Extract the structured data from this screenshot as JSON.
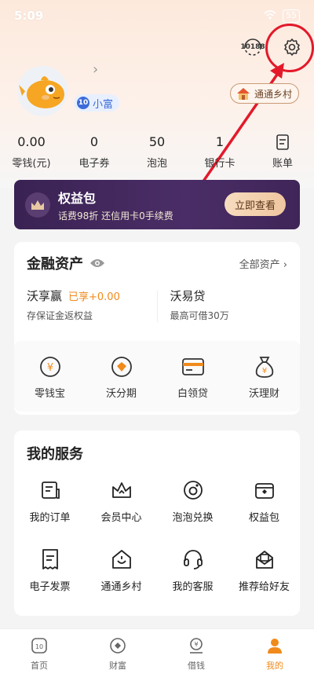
{
  "status_bar": {
    "time": "5:09",
    "battery": "55"
  },
  "header": {
    "badge_10188": "10188"
  },
  "profile": {
    "member_level": "小富",
    "member_badge_icon": "10",
    "village_label": "通通乡村"
  },
  "stats": [
    {
      "value": "0.00",
      "label": "零钱(元)"
    },
    {
      "value": "0",
      "label": "电子券"
    },
    {
      "value": "50",
      "label": "泡泡"
    },
    {
      "value": "1",
      "label": "银行卡"
    },
    {
      "value": "",
      "label": "账单"
    }
  ],
  "banner": {
    "title": "权益包",
    "subtitle": "话费98折 还信用卡0手续费",
    "button": "立即查看"
  },
  "finance": {
    "title": "金融资产",
    "all_assets": "全部资产",
    "products": [
      {
        "name": "沃享赢",
        "tag": "已享+0.00",
        "desc": "存保证金返权益"
      },
      {
        "name": "沃易贷",
        "tag": "",
        "desc": "最高可借30万"
      }
    ],
    "shortcuts": [
      {
        "label": "零钱宝",
        "icon": "coin-icon"
      },
      {
        "label": "沃分期",
        "icon": "installment-icon"
      },
      {
        "label": "白领贷",
        "icon": "card-icon"
      },
      {
        "label": "沃理财",
        "icon": "money-bag-icon"
      }
    ]
  },
  "services": {
    "title": "我的服务",
    "items": [
      {
        "label": "我的订单",
        "icon": "order-icon"
      },
      {
        "label": "会员中心",
        "icon": "crown-icon"
      },
      {
        "label": "泡泡兑换",
        "icon": "bubble-icon"
      },
      {
        "label": "权益包",
        "icon": "benefit-icon"
      },
      {
        "label": "电子发票",
        "icon": "invoice-icon"
      },
      {
        "label": "通通乡村",
        "icon": "village-icon"
      },
      {
        "label": "我的客服",
        "icon": "headset-icon"
      },
      {
        "label": "推荐给好友",
        "icon": "share-icon"
      }
    ]
  },
  "tabbar": [
    {
      "label": "首页",
      "active": false
    },
    {
      "label": "财富",
      "active": false
    },
    {
      "label": "借钱",
      "active": false
    },
    {
      "label": "我的",
      "active": true
    }
  ],
  "colors": {
    "accent": "#f08a1c",
    "annotation_red": "#e3192a",
    "banner_bg": "#3a2253"
  }
}
